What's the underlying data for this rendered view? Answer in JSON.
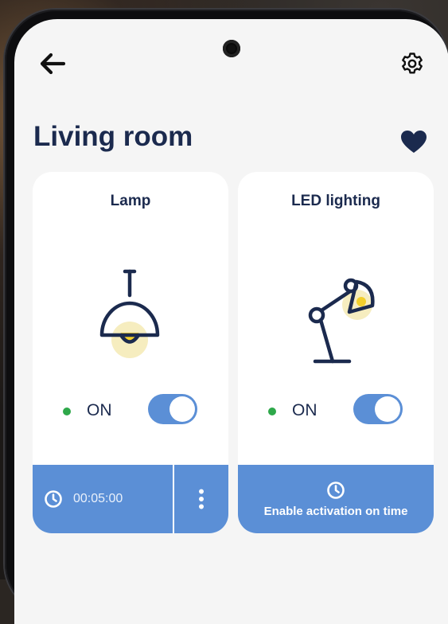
{
  "header": {
    "back_icon": "arrow-left-icon",
    "settings_icon": "gear-icon"
  },
  "room": {
    "title": "Living room",
    "favorite_icon": "heart-icon",
    "favorite": true
  },
  "devices": [
    {
      "name": "Lamp",
      "icon": "pendant-lamp-icon",
      "status": "ON",
      "enabled": true,
      "timer": "00:05:00",
      "timer_icon": "clock-icon",
      "more_icon": "more-vertical-icon"
    },
    {
      "name": "LED lighting",
      "icon": "desk-lamp-icon",
      "status": "ON",
      "enabled": true,
      "action_label": "Enable activation on time",
      "action_icon": "clock-icon"
    }
  ],
  "colors": {
    "accent": "#5b8fd6",
    "navy": "#1b2a4e",
    "status_on": "#2ea84a",
    "bulb_glow": "#f6edbf",
    "bulb": "#f2cf2c"
  }
}
